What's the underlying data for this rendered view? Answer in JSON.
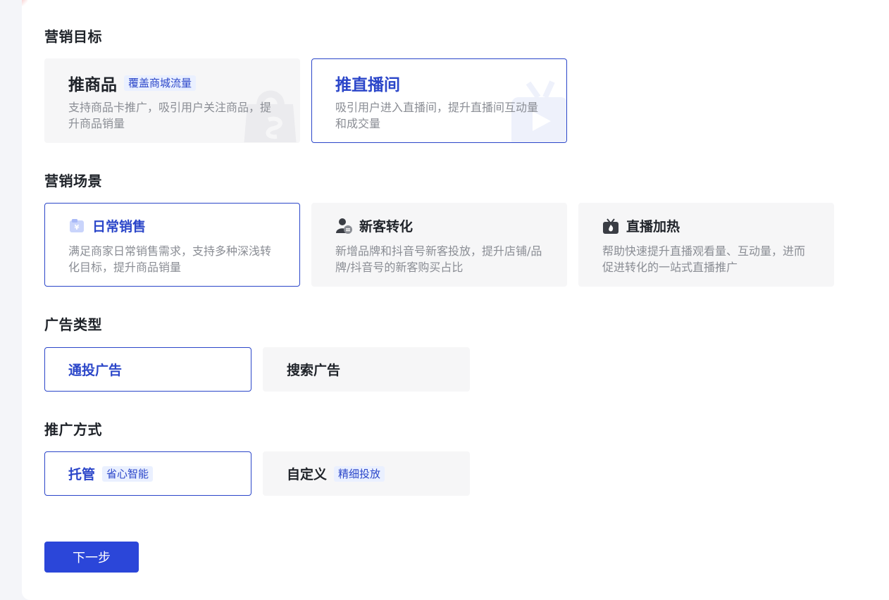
{
  "sections": {
    "goal": {
      "title": "营销目标",
      "cards": [
        {
          "label": "推商品",
          "tag": "覆盖商城流量",
          "desc": "支持商品卡推广，吸引用户关注商品，提升商品销量",
          "selected": false
        },
        {
          "label": "推直播间",
          "tag": "",
          "desc": "吸引用户进入直播间，提升直播间互动量和成交量",
          "selected": true
        }
      ]
    },
    "scene": {
      "title": "营销场景",
      "cards": [
        {
          "label": "日常销售",
          "desc": "满足商家日常销售需求，支持多种深浅转化目标，提升商品销量",
          "icon": "yuan-box-icon",
          "selected": true
        },
        {
          "label": "新客转化",
          "desc": "新增品牌和抖音号新客投放，提升店铺/品牌/抖音号的新客购买占比",
          "icon": "new-customer-icon",
          "selected": false
        },
        {
          "label": "直播加热",
          "desc": "帮助快速提升直播观看量、互动量，进而促进转化的一站式直播推广",
          "icon": "live-tv-fire-icon",
          "selected": false
        }
      ]
    },
    "ad_type": {
      "title": "广告类型",
      "cards": [
        {
          "label": "通投广告",
          "selected": true
        },
        {
          "label": "搜索广告",
          "selected": false
        }
      ]
    },
    "method": {
      "title": "推广方式",
      "cards": [
        {
          "label": "托管",
          "tag": "省心智能",
          "selected": true
        },
        {
          "label": "自定义",
          "tag": "精细投放",
          "selected": false
        }
      ]
    }
  },
  "actions": {
    "next_label": "下一步"
  },
  "colors": {
    "accent": "#2b46c9",
    "button": "#2b46d9",
    "card_bg": "#f6f6f7",
    "tag_bg": "#eaf0ff",
    "muted_text": "#8a8d94"
  }
}
